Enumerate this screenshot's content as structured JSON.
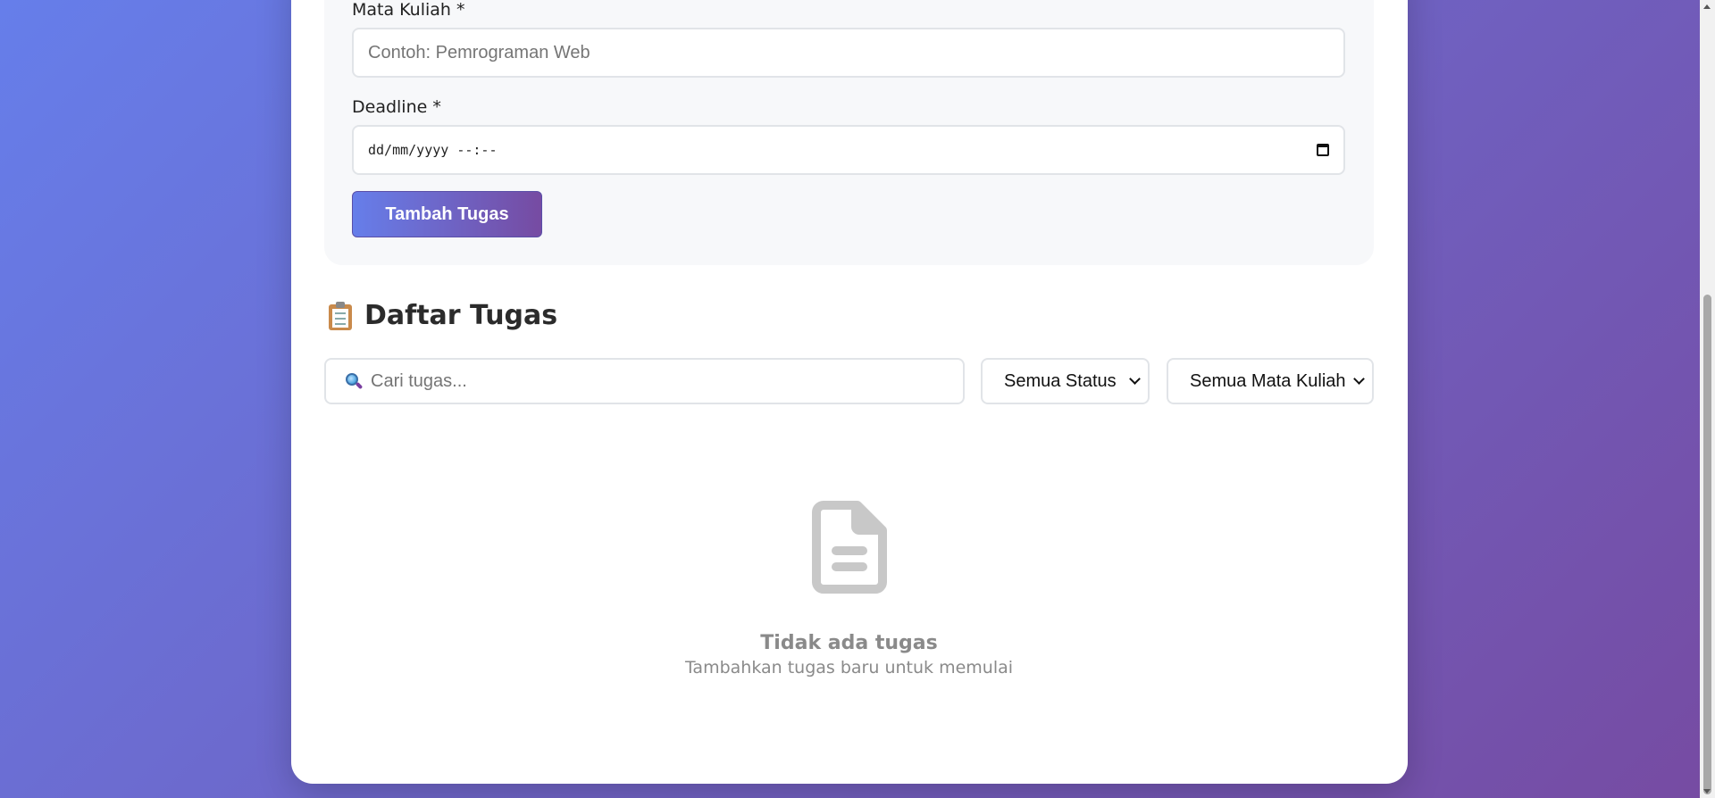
{
  "form": {
    "mata_kuliah_label": "Mata Kuliah *",
    "mata_kuliah_placeholder": "Contoh: Pemrograman Web",
    "deadline_label": "Deadline *",
    "deadline_placeholder": "dd/mm/yyyy --:--",
    "submit_label": "Tambah Tugas"
  },
  "list": {
    "title": "Daftar Tugas",
    "title_icon": "clipboard-icon",
    "search_placeholder": "Cari tugas...",
    "search_icon": "search-icon",
    "status_filter": "Semua Status",
    "course_filter": "Semua Mata Kuliah"
  },
  "empty_state": {
    "icon": "document-icon",
    "title": "Tidak ada tugas",
    "subtitle": "Tambahkan tugas baru untuk memulai"
  },
  "colors": {
    "gradient_start": "#667eea",
    "gradient_end": "#764ba2"
  }
}
